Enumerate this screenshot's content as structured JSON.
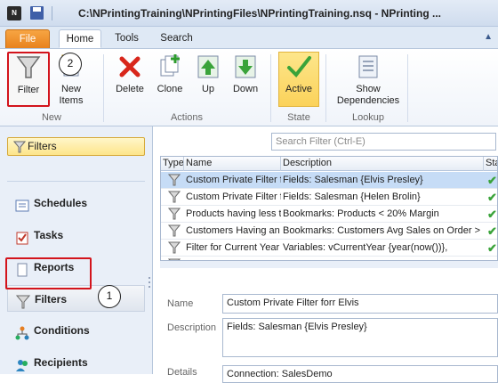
{
  "window": {
    "title": "C:\\NPrintingTraining\\NPrintingFiles\\NPrintingTraining.nsq - NPrinting ..."
  },
  "tabs": [
    {
      "label": "File"
    },
    {
      "label": "Home"
    },
    {
      "label": "Tools"
    },
    {
      "label": "Search"
    }
  ],
  "ribbon": {
    "filter": "Filter",
    "new_items": "New\nItems",
    "delete": "Delete",
    "clone": "Clone",
    "up": "Up",
    "down": "Down",
    "active": "Active",
    "show_dependencies": "Show\nDependencies",
    "groups": {
      "new": "New",
      "actions": "Actions",
      "state": "State",
      "lookup": "Lookup"
    }
  },
  "callouts": {
    "one": "1",
    "two": "2"
  },
  "left_panel": {
    "filter_bar": "Filters",
    "nav": [
      {
        "label": "Schedules",
        "icon": "schedule-icon"
      },
      {
        "label": "Tasks",
        "icon": "task-icon"
      },
      {
        "label": "Reports",
        "icon": "report-icon"
      },
      {
        "label": "Filters",
        "icon": "filter-icon"
      },
      {
        "label": "Conditions",
        "icon": "conditions-icon"
      },
      {
        "label": "Recipients",
        "icon": "recipients-icon"
      }
    ]
  },
  "search": {
    "placeholder": "Search Filter (Ctrl-E)"
  },
  "grid": {
    "columns": [
      "Type",
      "Name",
      "Description",
      "Sta"
    ],
    "rows": [
      {
        "name": "Custom Private Filter f",
        "description": "Fields: Salesman {Elvis Presley}",
        "selected": true
      },
      {
        "name": "Custom Private Filter f",
        "description": "Fields: Salesman {Helen Brolin}",
        "selected": false
      },
      {
        "name": "Products having less t",
        "description": "Bookmarks: Products < 20% Margin",
        "selected": false
      },
      {
        "name": "Customers Having an",
        "description": "Bookmarks: Customers Avg Sales on Order >",
        "selected": false
      },
      {
        "name": "Filter for Current Year",
        "description": "Variables: vCurrentYear {year(now())},",
        "selected": false
      },
      {
        "name": "Filter for Current Year",
        "description": "Variables: vCurrentYear {year(now())}",
        "selected": false
      }
    ]
  },
  "detail": {
    "name_label": "Name",
    "name_value": "Custom Private Filter forr Elvis",
    "description_label": "Description",
    "description_value": "Fields: Salesman {Elvis Presley}",
    "details_label": "Details",
    "details_value": "Connection: SalesDemo"
  },
  "colors": {
    "accent": "#e8821d",
    "highlight": "#d3141c",
    "selection": "#c6dcf6"
  }
}
